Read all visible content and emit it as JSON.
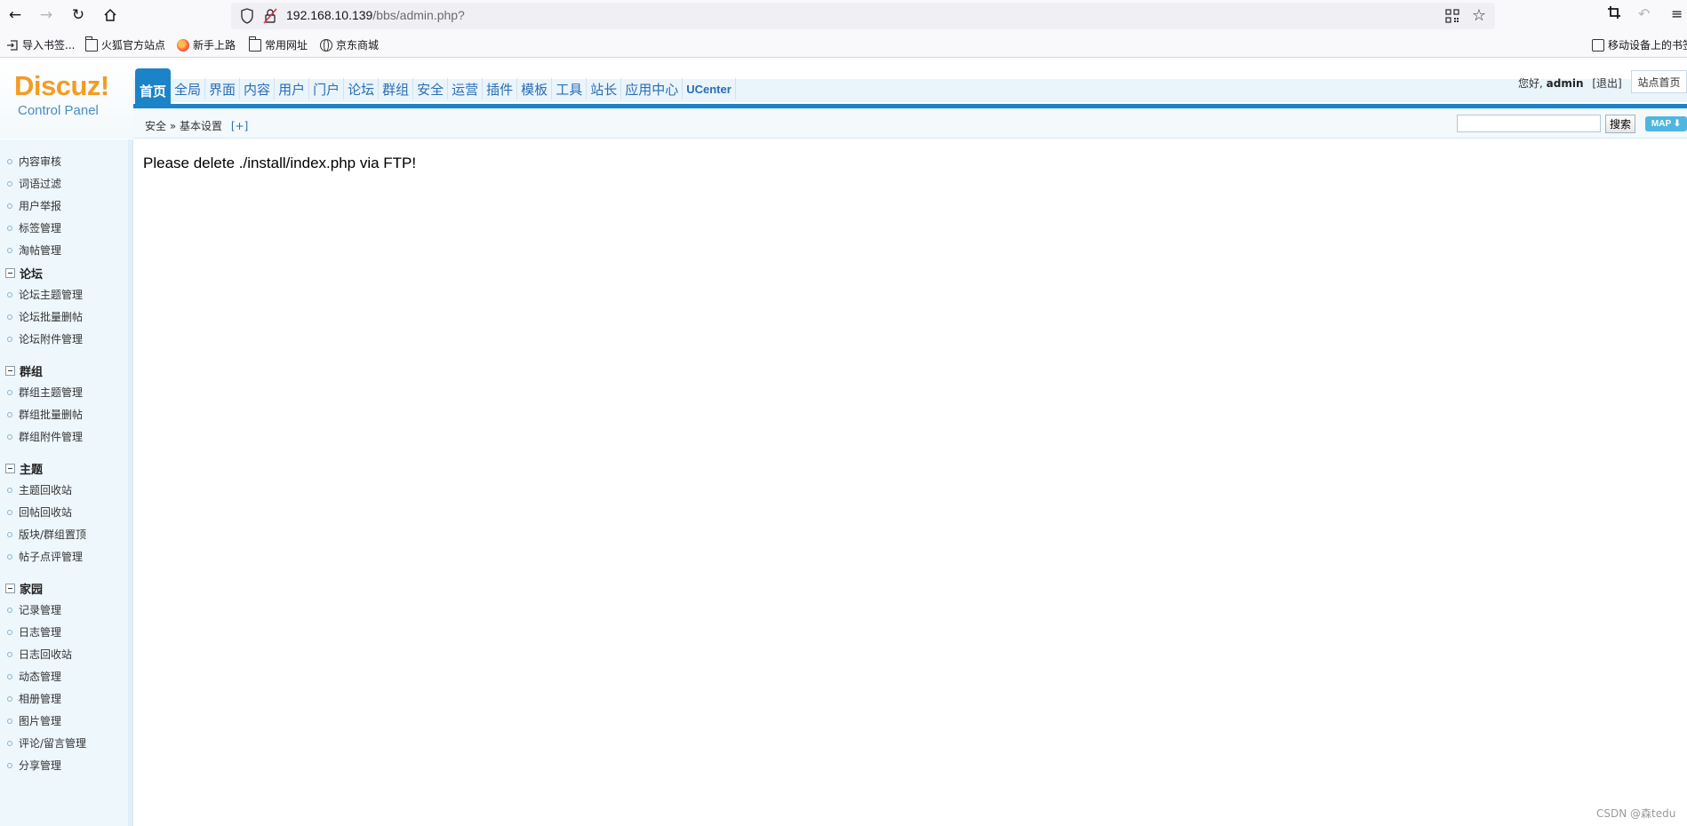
{
  "browser": {
    "url_host": "192.168.10.139",
    "url_path": "/bbs/admin.php?",
    "bookmarks": [
      {
        "label": "导入书签...",
        "icon": "import-icon"
      },
      {
        "label": "火狐官方站点",
        "icon": "folder-icon"
      },
      {
        "label": "新手上路",
        "icon": "firefox-icon"
      },
      {
        "label": "常用网址",
        "icon": "folder-icon"
      },
      {
        "label": "京东商城",
        "icon": "globe-icon"
      }
    ],
    "mobile_bookmarks": "移动设备上的书签"
  },
  "header": {
    "logo_text": "Discuz!",
    "logo_sub": "Control Panel",
    "nav": [
      "首页",
      "全局",
      "界面",
      "内容",
      "用户",
      "门户",
      "论坛",
      "群组",
      "安全",
      "运营",
      "插件",
      "模板",
      "工具",
      "站长",
      "应用中心",
      "UCenter"
    ],
    "active_nav": "首页",
    "greeting": "您好,",
    "username": "admin",
    "logout": "[退出]",
    "site_home": "站点首页"
  },
  "subbar": {
    "crumb_section": "安全",
    "crumb_sep": "»",
    "crumb_page": "基本设置",
    "crumb_add": "[+]",
    "search_button": "搜索",
    "map_button": "MAP ⬇"
  },
  "sidebar": {
    "items_top": [
      "内容审核",
      "词语过滤",
      "用户举报",
      "标签管理",
      "淘帖管理"
    ],
    "groups": [
      {
        "title": "论坛",
        "items": [
          "论坛主题管理",
          "论坛批量删帖",
          "论坛附件管理"
        ]
      },
      {
        "title": "群组",
        "items": [
          "群组主题管理",
          "群组批量删帖",
          "群组附件管理"
        ]
      },
      {
        "title": "主题",
        "items": [
          "主题回收站",
          "回帖回收站",
          "版块/群组置顶",
          "帖子点评管理"
        ]
      },
      {
        "title": "家园",
        "items": [
          "记录管理",
          "日志管理",
          "日志回收站",
          "动态管理",
          "相册管理",
          "图片管理",
          "评论/留言管理",
          "分享管理"
        ]
      }
    ]
  },
  "main": {
    "message": "Please delete ./install/index.php via FTP!"
  },
  "watermark": "CSDN @森tedu",
  "colors": {
    "accent": "#1b84c8",
    "logo": "#f49b23",
    "link": "#2a6eb5"
  }
}
